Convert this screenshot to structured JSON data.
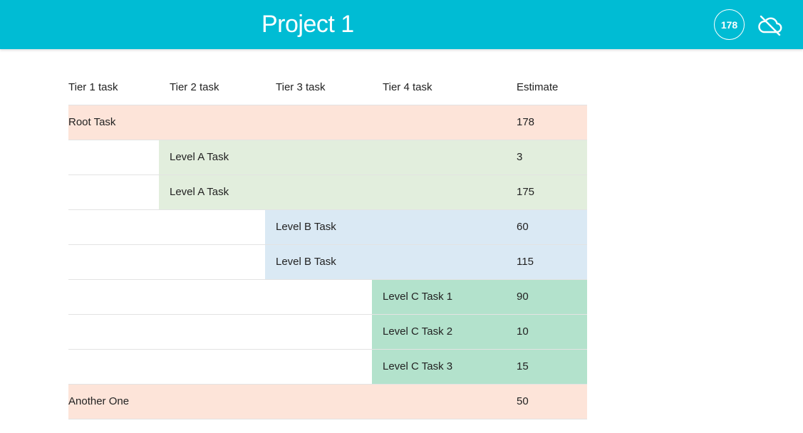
{
  "header": {
    "title": "Project 1",
    "total_badge": "178",
    "cloud_icon": "cloud-off-icon",
    "background": "#00bcd4"
  },
  "columns": [
    "Tier 1 task",
    "Tier 2 task",
    "Tier 3 task",
    "Tier 4 task",
    "Estimate"
  ],
  "colors": {
    "tier1": "#fde4d9",
    "tier2": "#e2eedd",
    "tier3": "#dae9f4",
    "tier4": "#b3e2cc"
  },
  "rows": [
    {
      "tier": 1,
      "name": "Root Task",
      "estimate": "178"
    },
    {
      "tier": 2,
      "name": "Level A Task",
      "estimate": "3"
    },
    {
      "tier": 2,
      "name": "Level A Task",
      "estimate": "175"
    },
    {
      "tier": 3,
      "name": "Level B Task",
      "estimate": "60"
    },
    {
      "tier": 3,
      "name": "Level B Task",
      "estimate": "115"
    },
    {
      "tier": 4,
      "name": "Level C Task 1",
      "estimate": "90"
    },
    {
      "tier": 4,
      "name": "Level C Task 2",
      "estimate": "10"
    },
    {
      "tier": 4,
      "name": "Level C Task 3",
      "estimate": "15"
    },
    {
      "tier": 1,
      "name": "Another One",
      "estimate": "50"
    }
  ]
}
